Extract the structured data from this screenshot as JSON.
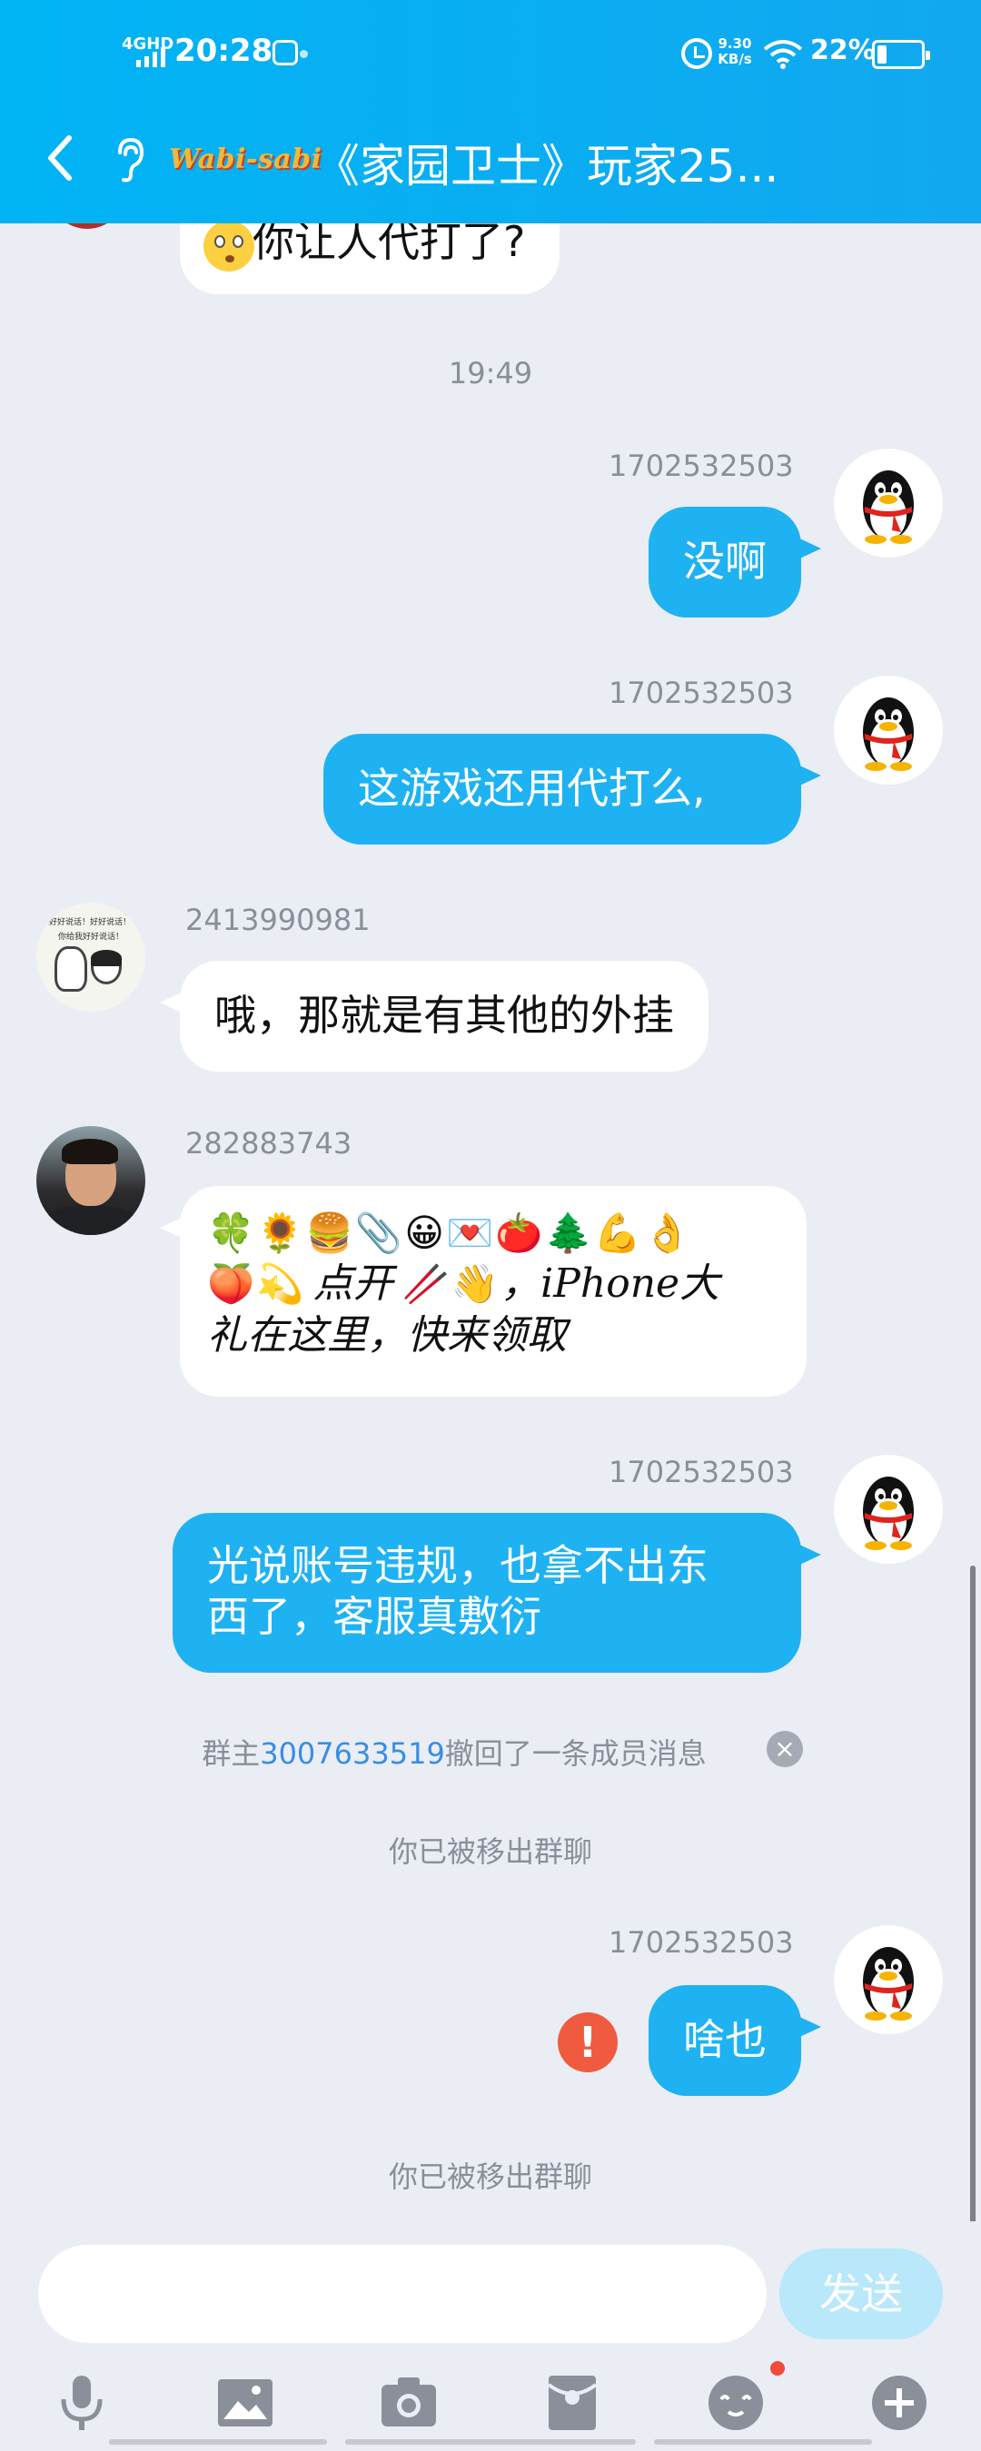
{
  "status_bar": {
    "network": "4GHD",
    "time": "20:28",
    "speed_value": "9.30",
    "speed_unit": "KB/s",
    "battery": "22%"
  },
  "header": {
    "logo_text": "Wabi-sabi",
    "title": "《家园卫士》玩家25..."
  },
  "messages": {
    "top_partial": "你让人代打了?",
    "time_1": "19:49",
    "m1": {
      "uid": "1702532503",
      "text": "没啊"
    },
    "m2": {
      "uid": "1702532503",
      "text": "这游戏还用代打么,"
    },
    "m3": {
      "uid": "2413990981",
      "text": "哦，那就是有其他的外挂",
      "avatar_caption_1": "好好说话！好好说话！",
      "avatar_caption_2": "你给我好好说话！"
    },
    "m4": {
      "uid": "282883743",
      "emojis": [
        "🍀",
        "🌻",
        "🍔",
        "📎",
        "😀",
        "💌",
        "🍅",
        "🌲",
        "💪",
        "👌"
      ],
      "line2_emojis": [
        "🍑",
        "💫"
      ],
      "line2_text_a": "点开",
      "line2_emoji_b": "🥢",
      "line2_emoji_c": "👋",
      "line2_text_b": "，iPhone大",
      "line3_text": "礼在这里，快来领取"
    },
    "m5": {
      "uid": "1702532503",
      "line1": "光说账号违规，也拿不出东",
      "line2": "西了，客服真敷衍"
    },
    "recall": {
      "prefix": "群主",
      "link": "3007633519",
      "suffix": "撤回了一条成员消息"
    },
    "removed_1": "你已被移出群聊",
    "m6": {
      "uid": "1702532503",
      "text": "啥也"
    },
    "removed_2": "你已被移出群聊"
  },
  "input": {
    "placeholder": "",
    "send_label": "发送"
  },
  "colors": {
    "header": "#12a8f0",
    "my_bubble": "#1eb2f3",
    "background": "#eaedf4",
    "error": "#f05a3e"
  }
}
